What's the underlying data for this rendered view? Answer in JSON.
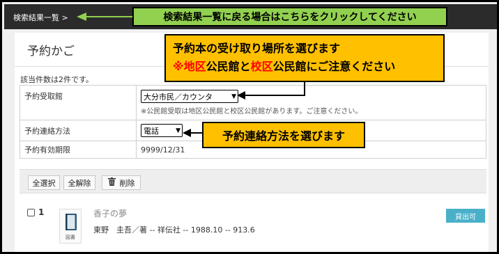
{
  "header": {
    "breadcrumb": "検索結果一覧 >"
  },
  "page": {
    "title": "予約かご",
    "result_count": "該当件数は2件です。"
  },
  "form": {
    "pickup": {
      "label": "予約受取館",
      "selected": "大分市民／カウンタ",
      "note": "※公民館受取は地区公民館と校区公民館があります。ご注意ください。"
    },
    "contact": {
      "label": "予約連絡方法",
      "selected": "電話"
    },
    "expiry": {
      "label": "予約有効期限",
      "value": "9999/12/31"
    }
  },
  "toolbar": {
    "select_all": "全選択",
    "deselect_all": "全解除",
    "delete": "削除"
  },
  "item": {
    "number": "1",
    "type_caption": "図書",
    "title": "香子の夢",
    "meta": "東野　圭吾／著 -- 祥伝社 -- 1988.10 -- 913.6",
    "status": "貸出可"
  },
  "callouts": {
    "back": "検索結果一覧に戻る場合はこちらをクリックしてください",
    "pickup_line1": "予約本の受け取り場所を選びます",
    "pickup_line2_prefix": "※",
    "pickup_line2_red1": "地区",
    "pickup_line2_mid": "公民館と",
    "pickup_line2_red2": "校区",
    "pickup_line2_suffix": "公民館にご注意ください",
    "contact": "予約連絡方法を選びます"
  },
  "colors": {
    "callout_green": "#92d050",
    "callout_orange": "#ffc000",
    "available_badge": "#4ab0c9",
    "highlight_red": "#ff0000"
  }
}
